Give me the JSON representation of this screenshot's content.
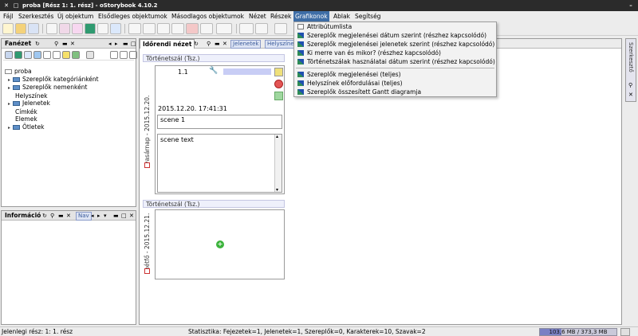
{
  "window": {
    "title": "proba [Rész 1: 1. rész] - oStorybook 4.10.2",
    "controls": [
      "✕",
      "□",
      "–"
    ]
  },
  "menubar": {
    "items": [
      "Fájl",
      "Szerkesztés",
      "Új objektum",
      "Elsődleges objektumok",
      "Másodlagos objektumok",
      "Nézet",
      "Részek",
      "Grafikonok",
      "Ablak",
      "Segítség"
    ],
    "active": "Grafikonok"
  },
  "grafikonok_menu": {
    "items": [
      "Attribútumlista",
      "Szereplők megjelenései dátum szerint (részhez kapcsolódó)",
      "Szereplők megjelenései jelenetek szerint (részhez kapcsolódó)",
      "Ki merre van és mikor? (részhez kapcsolódó)",
      "Történetszálak használatai dátum szerint (részhez kapcsolódó)",
      "Szereplők megjelenései (teljes)",
      "Helyszínek előfordulásai (teljes)",
      "Szereplők összesített Gantt diagramja"
    ]
  },
  "left_top_panel": {
    "title": "Fanézet",
    "tree": [
      {
        "label": "proba",
        "level": 0
      },
      {
        "label": "Szereplők kategóriánként",
        "level": 1,
        "folder": true
      },
      {
        "label": "Szereplők nemenként",
        "level": 1,
        "folder": true
      },
      {
        "label": "Helyszínek",
        "level": 1
      },
      {
        "label": "Jelenetek",
        "level": 1,
        "folder": true
      },
      {
        "label": "Címkék",
        "level": 1
      },
      {
        "label": "Elemek",
        "level": 1
      },
      {
        "label": "Ötletek",
        "level": 1,
        "folder": true
      }
    ]
  },
  "left_bottom_panel": {
    "title": "Információ",
    "tab2": "Nav"
  },
  "center_panel": {
    "title": "Időrendi nézet",
    "tabs": [
      "Jelenetek",
      "Helyszínek"
    ],
    "section1_header": "Történetszál (Tsz.)",
    "section1_side": "vasárnap - 2015.12.20.",
    "scene_number": "1.1",
    "scene_datetime": "2015.12.20. 17:41:31",
    "scene_title": "scene 1",
    "scene_text": "scene text",
    "section2_header": "Történetszál (Tsz.)",
    "section2_side": "hétfő - 2015.12.21."
  },
  "right_panel": {
    "tab": "Szerkesztő"
  },
  "statusbar": {
    "current_part": "Jelenlegi rész: 1: 1. rész",
    "stats": "Statisztika: Fejezetek=1,  Jelenetek=1,  Szereplők=0,  Karakterek=10,  Szavak=2",
    "memory": "103,6 MB / 373,3 MB",
    "memory_used_fraction": 0.278
  },
  "colors": {
    "menu_highlight": "#3f6ea7",
    "section_header_bg": "#eef0fb",
    "memory_fill": "#7a80c4"
  }
}
